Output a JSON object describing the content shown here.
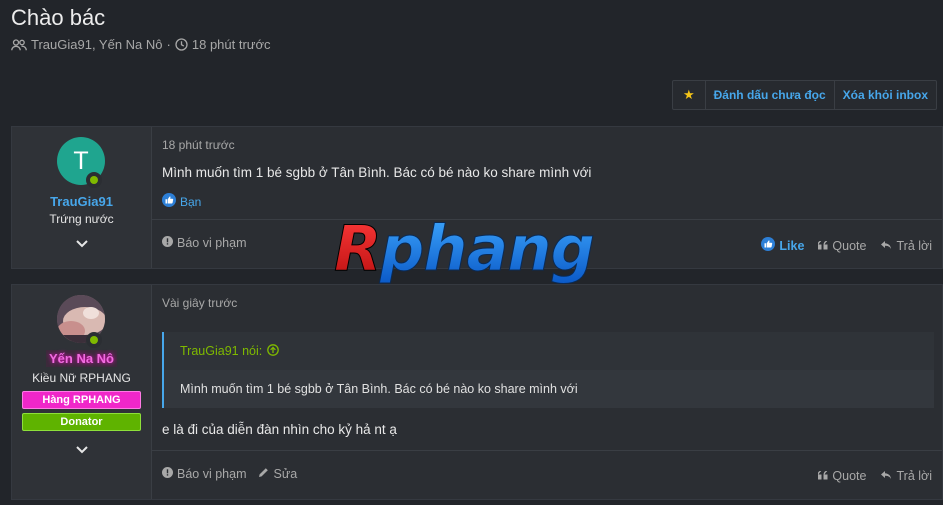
{
  "thread": {
    "title": "Chào bác",
    "participants": "TrauGia91, Yến Na Nô",
    "separator": "·",
    "time": "18 phút trước"
  },
  "actions": {
    "star_icon": "★",
    "mark_unread": "Đánh dấu chưa đọc",
    "remove_inbox": "Xóa khỏi inbox"
  },
  "watermark": "Rphang",
  "posts": [
    {
      "avatar_letter": "T",
      "username": "TrauGia91",
      "user_title": "Trứng nước",
      "time": "18 phút trước",
      "message": "Mình muốn tìm 1 bé sgbb ở Tân Bình. Bác có bé nào ko share mình với",
      "reaction": "Bạn",
      "report": "Báo vi phạm",
      "like": "Like",
      "quote": "Quote",
      "reply": "Trả lời"
    },
    {
      "username": "Yến Na Nô",
      "user_title": "Kiều Nữ RPHANG",
      "banner1": "Hàng RPHANG",
      "banner2": "Donator",
      "time": "Vài giây trước",
      "quote_author": "TrauGia91 nói:",
      "quote_text": "Mình muốn tìm 1 bé sgbb ở Tân Bình. Bác có bé nào ko share mình với",
      "message": "e là đi của diễn đàn nhìn cho kỷ hả nt ạ",
      "report": "Báo vi phạm",
      "edit": "Sửa",
      "quote": "Quote",
      "reply": "Trả lời"
    }
  ],
  "colors": {
    "link": "#47a7eb",
    "online": "#7fb900",
    "banner_pink": "#f027c9",
    "banner_green": "#5fb300",
    "username_pink": "#f06ce0"
  }
}
